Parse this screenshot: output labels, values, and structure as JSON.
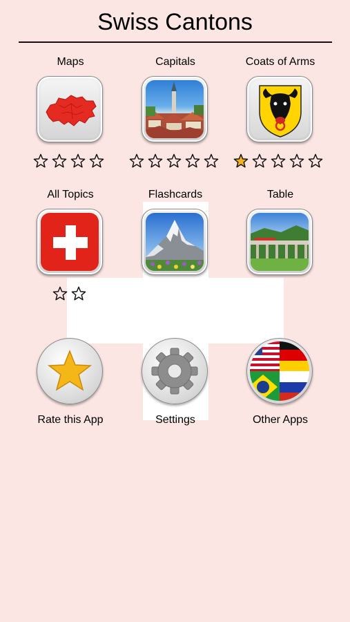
{
  "header": {
    "title": "Swiss Cantons"
  },
  "menu": {
    "row1": [
      {
        "label": "Maps",
        "icon": "switzerland-map-icon",
        "stars_total": 4,
        "stars_filled": 0
      },
      {
        "label": "Capitals",
        "icon": "city-photo-icon",
        "stars_total": 5,
        "stars_filled": 0
      },
      {
        "label": "Coats of Arms",
        "icon": "coat-of-arms-icon",
        "stars_total": 5,
        "stars_filled": 1
      }
    ],
    "row2": [
      {
        "label": "All Topics",
        "icon": "swiss-flag-icon",
        "stars_total": 2,
        "stars_filled": 0
      },
      {
        "label": "Flashcards",
        "icon": "matterhorn-photo-icon"
      },
      {
        "label": "Table",
        "icon": "viaduct-photo-icon"
      }
    ],
    "row3": [
      {
        "label": "Rate this App",
        "icon": "star-icon"
      },
      {
        "label": "Settings",
        "icon": "gear-icon"
      },
      {
        "label": "Other Apps",
        "icon": "flags-icon"
      }
    ]
  },
  "colors": {
    "background": "#fbe6e4",
    "star_filled": "#f2b21b",
    "swiss_red": "#e2231a"
  }
}
